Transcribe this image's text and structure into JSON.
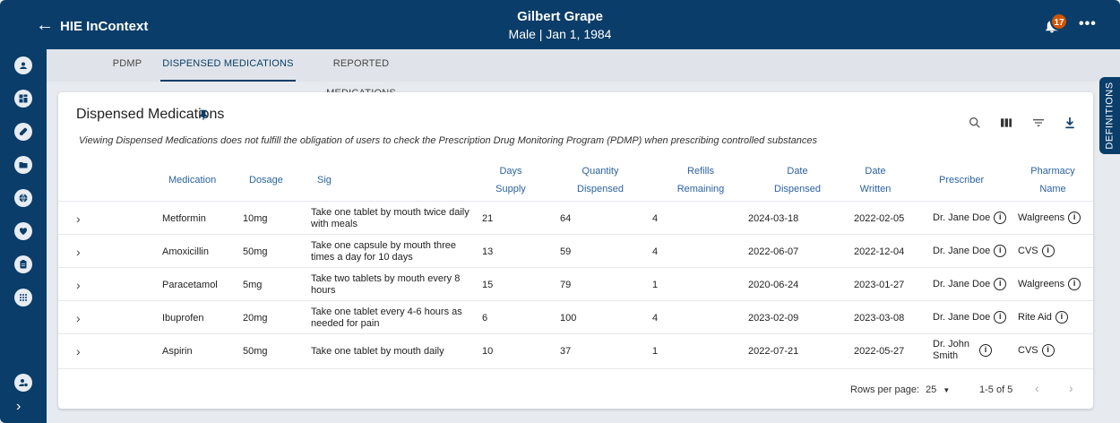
{
  "header": {
    "back_icon": "arrow-left-icon",
    "app_title": "HIE InContext",
    "patient_name": "Gilbert Grape",
    "patient_meta": "Male | Jan 1, 1984",
    "notification_count": "17",
    "more_label": "…"
  },
  "tabs": [
    {
      "label": "PDMP"
    },
    {
      "label": "DISPENSED MEDICATIONS"
    },
    {
      "label": "REPORTED MEDICATIONS"
    }
  ],
  "definitions_label": "DEFINITIONS",
  "card": {
    "title": "Dispensed Medications",
    "notice": "Viewing Dispensed Medications does not fulfill the obligation of users to check the Prescription Drug Monitoring Program (PDMP) when prescribing controlled substances"
  },
  "columns": {
    "medication": "Medication",
    "dosage": "Dosage",
    "sig": "Sig",
    "days_1": "Days",
    "days_2": "Supply",
    "qty_1": "Quantity",
    "qty_2": "Dispensed",
    "refills_1": "Refills",
    "refills_2": "Remaining",
    "dd_1": "Date",
    "dd_2": "Dispensed",
    "dw_1": "Date",
    "dw_2": "Written",
    "prescriber": "Prescriber",
    "pharm_1": "Pharmacy",
    "pharm_2": "Name"
  },
  "rows": [
    {
      "medication": "Metformin",
      "dosage": "10mg",
      "sig": "Take one tablet by mouth twice daily with meals",
      "days_supply": "21",
      "quantity": "64",
      "refills": "4",
      "date_dispensed": "2024-03-18",
      "date_written": "2022-02-05",
      "prescriber": "Dr. Jane Doe",
      "pharmacy": "Walgreens"
    },
    {
      "medication": "Amoxicillin",
      "dosage": "50mg",
      "sig": "Take one capsule by mouth three times a day for 10 days",
      "days_supply": "13",
      "quantity": "59",
      "refills": "4",
      "date_dispensed": "2022-06-07",
      "date_written": "2022-12-04",
      "prescriber": "Dr. Jane Doe",
      "pharmacy": "CVS"
    },
    {
      "medication": "Paracetamol",
      "dosage": "5mg",
      "sig": "Take two tablets by mouth every 8 hours",
      "days_supply": "15",
      "quantity": "79",
      "refills": "1",
      "date_dispensed": "2020-06-24",
      "date_written": "2023-01-27",
      "prescriber": "Dr. Jane Doe",
      "pharmacy": "Walgreens"
    },
    {
      "medication": "Ibuprofen",
      "dosage": "20mg",
      "sig": "Take one tablet every 4-6 hours as needed for pain",
      "days_supply": "6",
      "quantity": "100",
      "refills": "4",
      "date_dispensed": "2023-02-09",
      "date_written": "2023-03-08",
      "prescriber": "Dr. Jane Doe",
      "pharmacy": "Rite Aid"
    },
    {
      "medication": "Aspirin",
      "dosage": "50mg",
      "sig": "Take one tablet by mouth daily",
      "days_supply": "10",
      "quantity": "37",
      "refills": "1",
      "date_dispensed": "2022-07-21",
      "date_written": "2022-05-27",
      "prescriber": "Dr. John Smith",
      "pharmacy": "CVS"
    }
  ],
  "pagination": {
    "rows_per_page_label": "Rows per page:",
    "rows_per_page_value": "25",
    "range": "1-5 of 5"
  },
  "colors": {
    "primary": "#0a3d69",
    "accent_text": "#2b62a1",
    "badge": "#d35400"
  }
}
